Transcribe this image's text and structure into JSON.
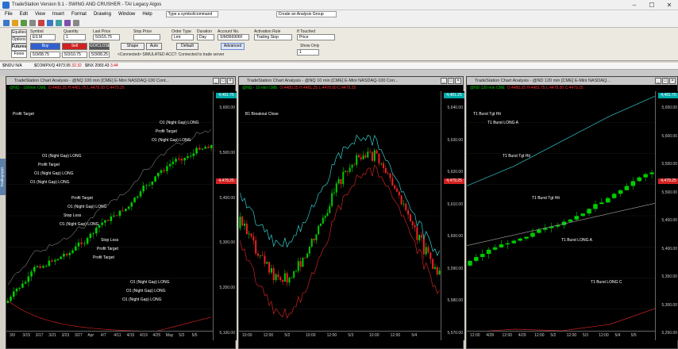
{
  "window": {
    "title": "TradeStation Version 9.1 - SWING AND CRUSHER - TAI Legacy Algos",
    "btn_min": "–",
    "btn_max": "☐",
    "btn_close": "✕"
  },
  "menu": {
    "items": [
      "File",
      "Edit",
      "View",
      "Insert",
      "Format",
      "Drawing",
      "Window",
      "Help"
    ],
    "combo_symbol": "Type a symbol/command",
    "combo_group": "Create an Analysis Group"
  },
  "order_bar": {
    "sides": [
      "Equities",
      "Options",
      "Futures",
      "Forex"
    ],
    "labels": {
      "symbol": "Symbol",
      "quantity": "Quantity",
      "last_price": "Last Price",
      "stop_price": "Stop Price",
      "order_type": "Order Type",
      "duration": "Duration",
      "account": "Account No.",
      "activation": "Activation Rule",
      "if_touched": "If Touched",
      "show_only": "Show Only"
    },
    "values": {
      "symbol": "ES M",
      "quantity": "1",
      "last_price": "5/3/15.75",
      "order_type": "Lmt",
      "duration": "Day",
      "account": "SIM366906F",
      "trailing": "Trailing Stop",
      "price": "Price",
      "show_only_val": "1",
      "bid": "5/3/08.75",
      "ask": "5/3/10.75",
      "bid2": "5/3/08.25"
    },
    "buttons": {
      "buy": "Buy",
      "sell": "Sell",
      "go_close": "GO/CLOSE",
      "shape": "Shape",
      "auto": "Auto",
      "default": "Default",
      "advanced": "Advanced",
      "sim": "<Connected> SIMULATED ACCT: Connected to trade server"
    }
  },
  "status": {
    "symbol": "$INDU N/A",
    "nq": "$COMPX/Q 4973.95",
    "nqchg": "32.32",
    "es": "$INX 2083.43",
    "eschg": "3.44"
  },
  "side_tab": "TradingApps",
  "charts": [
    {
      "title": "TradeStation Chart Analysis - @NQ 100 min [CME] E-Mini NASDAQ-100 Cont...",
      "status": "@NQ - 100min CME",
      "status_ohlc": "O:4480.25 H:4481.75 L:4478.00 C:4479.25",
      "price_ticks": [
        "5,600.00",
        "5,500.00",
        "5,400.00",
        "5,300.00",
        "5,200.00",
        "5,100.00"
      ],
      "tag_top": "4,481.75",
      "tag_mid": "4,479.25",
      "time_ticks": [
        "3/9",
        "3/15",
        "3/17",
        "3/21",
        "3/23",
        "3/27",
        "Apr",
        "4/7",
        "4/11",
        "4/15",
        "4/19",
        "4/25",
        "May",
        "5/3",
        "5/5"
      ],
      "labels": [
        "Profit Target",
        "O1 (Night Gap) LONG",
        "Profit Target",
        "Stop Loss",
        "O1 (Night Gap) LONG",
        "O1 (Night Gap) LONG",
        "Profit Target",
        "O1 (Night Gap) LONG",
        "Profit Target",
        "O1 (Night Gap) LONG",
        "Profit Target",
        "O1 (Night Gap) LONG",
        "Stop Loss",
        "Profit Target",
        "O1 (Night Gap) LONG",
        "O1 (Night Gap) LONG",
        "O1 (Night Gap) LONG",
        "O1 (Night Gap) LONG"
      ]
    },
    {
      "title": "TradeStation Chart Analysis - @NQ 10 min [CME] E-Mini NASDAQ-100 Con...",
      "status": "@NQ - 10 min CME",
      "status_ohlc": "O:4480.25 H:4481.25 L:4478.00 C:4479.25",
      "price_ticks": [
        "5,640.00",
        "5,630.00",
        "5,620.00",
        "5,610.00",
        "5,600.00",
        "5,590.00",
        "5,580.00",
        "5,570.00"
      ],
      "tag_top": "4,481.25",
      "tag_mid": "4,479.25",
      "time_ticks": [
        "10:00",
        "12:00",
        "5/2",
        "10:00",
        "12:00",
        "5/3",
        "10:00",
        "12:00",
        "5/4"
      ],
      "labels": [
        "B1 Breakout Close"
      ]
    },
    {
      "title": "TradeStation Chart Analysis - @ND 120 min [CME] E-Mini NASDAQ...",
      "status": "@ND 120 min CME",
      "status_ohlc": "O:4480.25 H:4481.75 L:4478.00 C:4479.25",
      "price_ticks": [
        "5,650.00",
        "5,600.00",
        "5,550.00",
        "5,500.00",
        "5,450.00",
        "5,400.00",
        "5,350.00",
        "5,300.00",
        "5,250.00"
      ],
      "tag_top": "4,481.75",
      "tag_mid": "4,479.25",
      "time_ticks": [
        "12:00",
        "4/28",
        "12:00",
        "4/29",
        "12:00",
        "5/2",
        "12:00",
        "5/3",
        "12:00",
        "5/4",
        "5/5"
      ],
      "labels": [
        "T1 Burst Tgt Hit",
        "T1 Burst Tgt Hit",
        "T1 Burst Tgt Hit",
        "T1 Burst LONG A",
        "T1 Burst LONG C",
        "T1 Burst LONG A"
      ]
    }
  ]
}
